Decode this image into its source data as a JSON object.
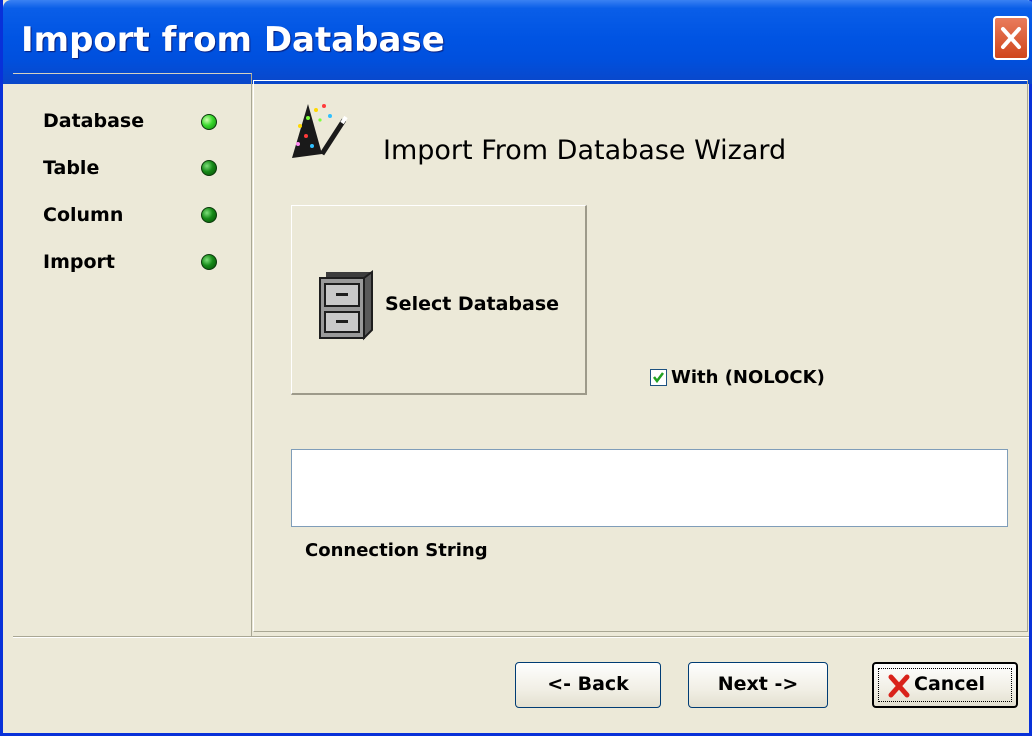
{
  "window": {
    "title": "Import from Database",
    "close_icon": "close-icon"
  },
  "steps": [
    {
      "label": "Database",
      "status": "active",
      "icon": "status-led-icon"
    },
    {
      "label": "Table",
      "status": "inactive",
      "icon": "status-led-icon"
    },
    {
      "label": "Column",
      "status": "inactive",
      "icon": "status-led-icon"
    },
    {
      "label": "Import",
      "status": "inactive",
      "icon": "status-led-icon"
    }
  ],
  "main": {
    "wizard_title": "Import From Database Wizard",
    "wizard_icon": "magic-wand-icon",
    "select_button_label": "Select Database",
    "select_button_icon": "file-cabinet-icon",
    "nolock_label": "With (NOLOCK)",
    "nolock_checked": true,
    "connection_string_value": "",
    "connection_string_label": "Connection String"
  },
  "footer": {
    "back_label": "<- Back",
    "next_label": "Next ->",
    "cancel_label": "Cancel",
    "cancel_icon": "red-x-icon"
  },
  "colors": {
    "titlebar": "#0054e3",
    "window_bg": "#ece9d8",
    "led_active": "#38d92c",
    "led_inactive": "#168a18",
    "cancel_x": "#d9231b"
  }
}
